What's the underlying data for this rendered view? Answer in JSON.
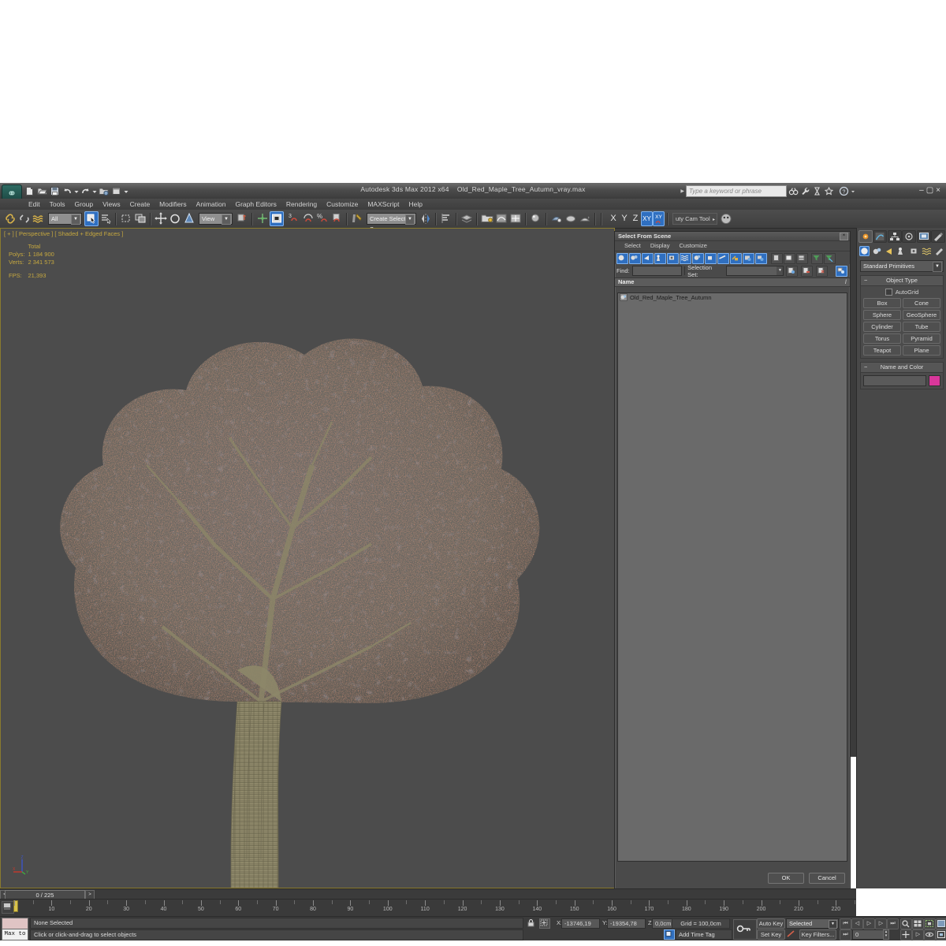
{
  "app": {
    "title_app": "Autodesk 3ds Max  2012 x64",
    "title_file": "Old_Red_Maple_Tree_Autumn_vray.max",
    "logo": "3dsmax-logo-icon"
  },
  "quick_access": {
    "buttons": [
      {
        "name": "new-file-icon",
        "label": "New"
      },
      {
        "name": "open-file-icon",
        "label": "Open"
      },
      {
        "name": "save-file-icon",
        "label": "Save"
      },
      {
        "name": "undo-icon",
        "label": "Undo"
      },
      {
        "name": "undo-dropdown-icon",
        "label": "▾"
      },
      {
        "name": "redo-icon",
        "label": "Redo"
      },
      {
        "name": "redo-dropdown-icon",
        "label": "▾"
      },
      {
        "name": "set-project-folder-icon",
        "label": "Project Folder"
      },
      {
        "name": "workspace-icon",
        "label": "Workspace"
      },
      {
        "name": "qat-dropdown-icon",
        "label": "▾"
      }
    ]
  },
  "search": {
    "placeholder": "Type a keyword or phrase",
    "icons": [
      "binoculars-icon",
      "wrench-icon",
      "hourglass-icon",
      "star-icon",
      "help-icon",
      "help-dropdown-icon"
    ]
  },
  "window_buttons": {
    "minimize": "–",
    "restore": "▢",
    "close": "×"
  },
  "menu": {
    "items": [
      "Edit",
      "Tools",
      "Group",
      "Views",
      "Create",
      "Modifiers",
      "Animation",
      "Graph Editors",
      "Rendering",
      "Customize",
      "MAXScript",
      "Help"
    ]
  },
  "main_toolbar": {
    "selection_filter": "All",
    "reference_coordinate_system": "View",
    "named_selection_set": "Create Selection Se",
    "axis_constraints": [
      "X",
      "Y",
      "Z",
      "XY"
    ],
    "workspace_label": "uty Cam Tool",
    "items": [
      {
        "name": "select-and-link-icon",
        "on": false
      },
      {
        "name": "unlink-selection-icon",
        "on": false
      },
      {
        "name": "bind-to-space-warp-icon",
        "on": false
      },
      {
        "name": "select-object-icon",
        "on": true
      },
      {
        "name": "select-by-name-icon",
        "on": false
      },
      {
        "name": "rectangular-selection-region-icon",
        "on": false
      },
      {
        "name": "window-crossing-toggle-icon",
        "on": false
      },
      {
        "name": "select-and-move-icon",
        "on": false
      },
      {
        "name": "select-and-rotate-icon",
        "on": false
      },
      {
        "name": "select-and-scale-icon",
        "on": false
      },
      {
        "name": "use-pivot-point-center-icon",
        "on": false
      },
      {
        "name": "select-and-manipulate-icon",
        "on": false
      },
      {
        "name": "snaps-toggle-icon",
        "on": true
      },
      {
        "name": "angle-snap-toggle-icon",
        "on": false
      },
      {
        "name": "percent-snap-toggle-icon",
        "on": false
      },
      {
        "name": "spinner-snap-toggle-icon",
        "on": false
      },
      {
        "name": "edit-named-selection-sets-icon",
        "on": false
      },
      {
        "name": "mirror-icon",
        "on": false
      },
      {
        "name": "align-icon",
        "on": false
      },
      {
        "name": "layer-manager-icon",
        "on": false
      },
      {
        "name": "scene-explorer-icon",
        "on": false
      },
      {
        "name": "curve-editor-icon",
        "on": false
      },
      {
        "name": "schematic-view-icon",
        "on": false
      },
      {
        "name": "material-editor-icon",
        "on": false
      },
      {
        "name": "render-setup-icon",
        "on": false
      },
      {
        "name": "rendered-frame-window-icon",
        "on": false
      },
      {
        "name": "render-production-icon",
        "on": false
      }
    ]
  },
  "viewport": {
    "label": "[ + ] [ Perspective ] [ Shaded + Edged Faces ]",
    "stats": {
      "header": "Total",
      "rows": [
        {
          "label": "Polys:",
          "value": "1 184 900"
        },
        {
          "label": "Verts:",
          "value": "2 341 573"
        }
      ],
      "fps_label": "FPS:",
      "fps_value": "21,393"
    },
    "axis_tripod": {
      "x": "X",
      "y": "Y",
      "z": "Z",
      "x_color": "#c8392b",
      "y_color": "#3fae3f",
      "z_color": "#3c56c8"
    },
    "model_colors": {
      "background": "#4c4c4c",
      "canopy_mesh": "#6d6a67",
      "leaf_highlight": "#e0543a",
      "leaf_highlight_2": "#f2873c",
      "branch": "#8c8566",
      "shadow": "#3a3a3d"
    }
  },
  "dialog": {
    "title": "Select From Scene",
    "close": "×",
    "menu": [
      "Select",
      "Display",
      "Customize"
    ],
    "find_label": "Find:",
    "find_value": "",
    "selection_set_label": "Selection Set:",
    "selection_set_value": "",
    "list_header": "Name",
    "list_sort_glyph": "/",
    "items": [
      {
        "name": "Old_Red_Maple_Tree_Autumn",
        "icon": "geometry-object-icon"
      }
    ],
    "buttons": {
      "ok": "OK",
      "cancel": "Cancel"
    },
    "toolbar_icons": [
      {
        "name": "display-geometry-icon",
        "on": true
      },
      {
        "name": "display-shapes-icon",
        "on": true
      },
      {
        "name": "display-lights-icon",
        "on": true
      },
      {
        "name": "display-cameras-icon",
        "on": true
      },
      {
        "name": "display-helpers-icon",
        "on": true
      },
      {
        "name": "display-space-warps-icon",
        "on": true
      },
      {
        "name": "display-groups-icon",
        "on": true
      },
      {
        "name": "display-external-references-icon",
        "on": true
      },
      {
        "name": "display-bone-objects-icon",
        "on": true
      },
      {
        "name": "display-frozen-icon",
        "on": true
      },
      {
        "name": "display-hidden-icon",
        "on": true
      },
      {
        "name": "display-children-icon",
        "on": true
      },
      {
        "name": "display-influences-icon",
        "on": false
      },
      {
        "name": "expand-all-icon",
        "on": false
      },
      {
        "name": "collapse-all-icon",
        "on": false
      },
      {
        "name": "filter-icon",
        "on": false
      },
      {
        "name": "clear-filter-icon",
        "on": false
      },
      {
        "name": "select-set-add-icon",
        "on": false
      },
      {
        "name": "select-set-remove-icon",
        "on": false
      },
      {
        "name": "select-set-delete-icon",
        "on": false
      },
      {
        "name": "select-subtree-icon",
        "on": true
      }
    ]
  },
  "command_panel": {
    "tabs": [
      {
        "name": "create-tab-icon",
        "on": true
      },
      {
        "name": "modify-tab-icon",
        "on": false
      },
      {
        "name": "hierarchy-tab-icon",
        "on": false
      },
      {
        "name": "motion-tab-icon",
        "on": false
      },
      {
        "name": "display-tab-icon",
        "on": false
      },
      {
        "name": "utilities-tab-icon",
        "on": false
      }
    ],
    "category_icons": [
      {
        "name": "geometry-category-icon",
        "on": true
      },
      {
        "name": "shapes-category-icon",
        "on": false
      },
      {
        "name": "lights-category-icon",
        "on": false
      },
      {
        "name": "cameras-category-icon",
        "on": false
      },
      {
        "name": "helpers-category-icon",
        "on": false
      },
      {
        "name": "space-warps-category-icon",
        "on": false
      },
      {
        "name": "systems-category-icon",
        "on": false
      }
    ],
    "subcategory": "Standard Primitives",
    "object_type": {
      "header": "Object Type",
      "autogrid_label": "AutoGrid",
      "autogrid_checked": false,
      "buttons": [
        "Box",
        "Cone",
        "Sphere",
        "GeoSphere",
        "Cylinder",
        "Tube",
        "Torus",
        "Pyramid",
        "Teapot",
        "Plane"
      ]
    },
    "name_and_color": {
      "header": "Name and Color",
      "name_value": "",
      "color": "#d9379b"
    }
  },
  "time_slider": {
    "current": "0 / 225",
    "prev_glyph": "<",
    "next_glyph": ">"
  },
  "track_bar": {
    "ticks": [
      10,
      20,
      30,
      40,
      50,
      60,
      70,
      80,
      90,
      100,
      110,
      120,
      130,
      140,
      150,
      160,
      170,
      180,
      190,
      200,
      210,
      220
    ],
    "range_end": 225
  },
  "status_bar": {
    "selection_status": "None Selected",
    "prompt": "Click or click-and-drag to select objects",
    "max_to_label": "Max to",
    "lock_icon": "lock-selection-icon",
    "absolute_mode_icon": "absolute-relative-transform-icon",
    "coords": [
      {
        "axis": "X:",
        "value": "-13746,19"
      },
      {
        "axis": "Y:",
        "value": "-19354,78"
      },
      {
        "axis": "Z:",
        "value": "0,0cm"
      }
    ],
    "grid_label": "Grid = 100,0cm",
    "add_time_tag": "Add Time Tag",
    "key_mode_icon": "key-mode-toggle-icon"
  },
  "animation": {
    "auto_key": "Auto Key",
    "set_key": "Set Key",
    "filter_mode": "Selected",
    "key_filters": "Key Filters...",
    "frame_value": "0",
    "playback": [
      {
        "name": "go-to-start-icon",
        "glyph": "⏮"
      },
      {
        "name": "previous-frame-icon",
        "glyph": "◁"
      },
      {
        "name": "play-animation-icon",
        "glyph": "▷"
      },
      {
        "name": "next-frame-icon",
        "glyph": "▷"
      },
      {
        "name": "go-to-end-icon",
        "glyph": "⏭"
      }
    ],
    "viewport_nav": [
      {
        "name": "zoom-icon"
      },
      {
        "name": "zoom-all-icon"
      },
      {
        "name": "zoom-extents-icon"
      },
      {
        "name": "zoom-region-icon"
      },
      {
        "name": "pan-view-icon"
      },
      {
        "name": "orbit-icon"
      },
      {
        "name": "maximize-viewport-toggle-icon"
      }
    ]
  }
}
